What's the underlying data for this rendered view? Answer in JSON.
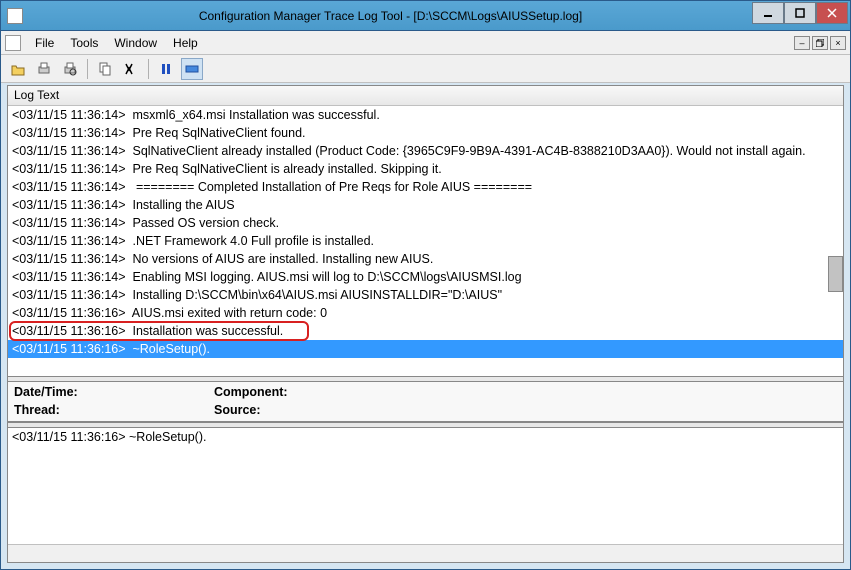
{
  "window": {
    "title": "Configuration Manager Trace Log Tool - [D:\\SCCM\\Logs\\AIUSSetup.log]"
  },
  "menu": {
    "file": "File",
    "tools": "Tools",
    "window": "Window",
    "help": "Help"
  },
  "column_header": "Log Text",
  "log": [
    {
      "ts": "<03/11/15 11:36:14>",
      "msg": "msxml6_x64.msi Installation was successful."
    },
    {
      "ts": "<03/11/15 11:36:14>",
      "msg": "Pre Req SqlNativeClient found."
    },
    {
      "ts": "<03/11/15 11:36:14>",
      "msg": "SqlNativeClient already installed (Product Code: {3965C9F9-9B9A-4391-AC4B-8388210D3AA0}). Would not install again."
    },
    {
      "ts": "<03/11/15 11:36:14>",
      "msg": "Pre Req SqlNativeClient is already installed. Skipping it."
    },
    {
      "ts": "<03/11/15 11:36:14>",
      "msg": "         ======== Completed Installation of Pre Reqs for Role AIUS ========"
    },
    {
      "ts": "<03/11/15 11:36:14>",
      "msg": "Installing the AIUS"
    },
    {
      "ts": "<03/11/15 11:36:14>",
      "msg": "Passed OS version check."
    },
    {
      "ts": "<03/11/15 11:36:14>",
      "msg": ".NET Framework 4.0 Full profile is installed."
    },
    {
      "ts": "<03/11/15 11:36:14>",
      "msg": "No versions of AIUS are installed.  Installing new AIUS."
    },
    {
      "ts": "<03/11/15 11:36:14>",
      "msg": "Enabling MSI logging.  AIUS.msi will log to D:\\SCCM\\logs\\AIUSMSI.log"
    },
    {
      "ts": "<03/11/15 11:36:14>",
      "msg": "Installing D:\\SCCM\\bin\\x64\\AIUS.msi AIUSINSTALLDIR=\"D:\\AIUS\""
    },
    {
      "ts": "<03/11/15 11:36:16>",
      "msg": "AIUS.msi exited with return code: 0"
    },
    {
      "ts": "<03/11/15 11:36:16>",
      "msg": "Installation was successful."
    },
    {
      "ts": "<03/11/15 11:36:16>",
      "msg": "~RoleSetup()."
    }
  ],
  "highlighted_index": 12,
  "selected_index": 13,
  "details": {
    "datetime_label": "Date/Time:",
    "datetime_value": "",
    "component_label": "Component:",
    "component_value": "",
    "thread_label": "Thread:",
    "thread_value": "",
    "source_label": "Source:",
    "source_value": ""
  },
  "text_pane": "<03/11/15 11:36:16> ~RoleSetup()."
}
